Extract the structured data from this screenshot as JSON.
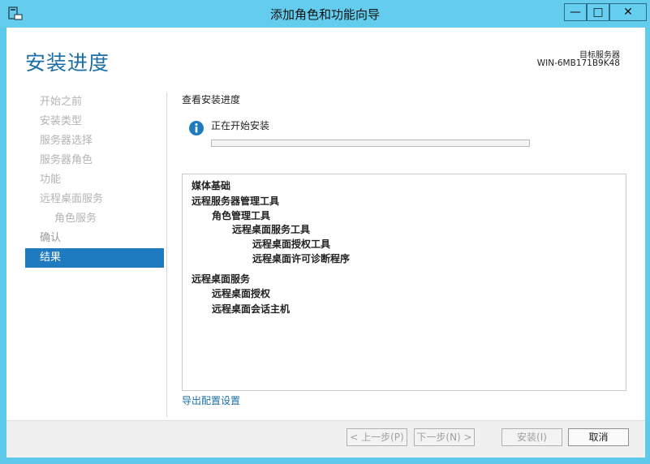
{
  "window": {
    "title": "添加角色和功能向导",
    "minimize": "—",
    "maximize": "□",
    "close": "✕"
  },
  "header": {
    "page_title": "安装进度",
    "server_label": "目标服务器",
    "server_name": "WIN-6MB171B9K48"
  },
  "nav": {
    "items": [
      {
        "label": "开始之前"
      },
      {
        "label": "安装类型"
      },
      {
        "label": "服务器选择"
      },
      {
        "label": "服务器角色"
      },
      {
        "label": "功能"
      },
      {
        "label": "远程桌面服务"
      },
      {
        "label": "角色服务"
      },
      {
        "label": "确认"
      },
      {
        "label": "结果"
      }
    ]
  },
  "content": {
    "title": "查看安装进度",
    "status": "正在开始安装",
    "progress": 0,
    "results": [
      "媒体基础",
      "远程服务器管理工具",
      "角色管理工具",
      "远程桌面服务工具",
      "远程桌面授权工具",
      "远程桌面许可诊断程序",
      "远程桌面服务",
      "远程桌面授权",
      "远程桌面会话主机"
    ],
    "export_link": "导出配置设置"
  },
  "footer": {
    "prev": "< 上一步(P)",
    "next": "下一步(N) >",
    "install": "安装(I)",
    "cancel": "取消"
  },
  "colors": {
    "accent": "#1e7bc0",
    "titlebar": "#64cdee"
  }
}
